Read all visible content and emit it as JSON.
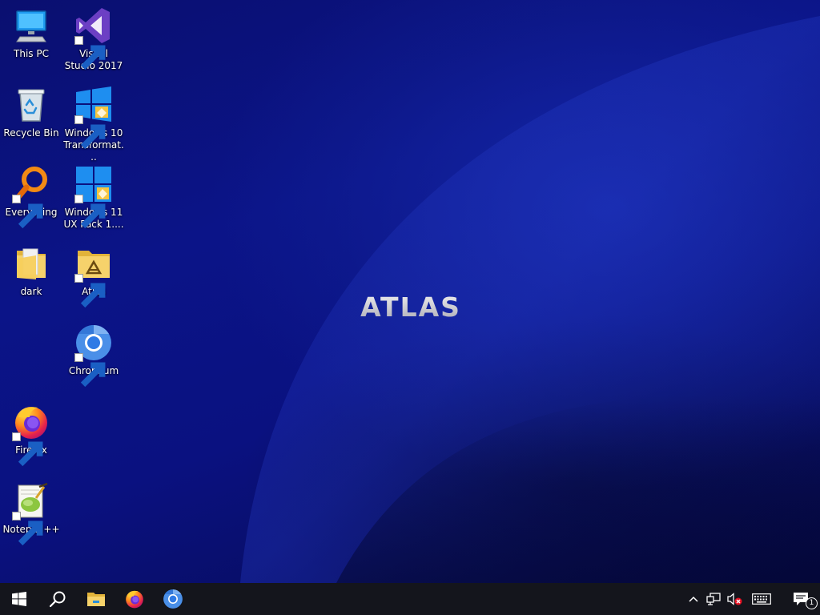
{
  "desktop": {
    "wallpaper_logo_text": "ATLAS",
    "icons": [
      {
        "label": "This PC",
        "icon": "this-pc-icon",
        "shortcut": false
      },
      {
        "label": "Visual Studio 2017",
        "icon": "visual-studio-icon",
        "shortcut": true
      },
      {
        "label": "Recycle Bin",
        "icon": "recycle-bin-icon",
        "shortcut": false
      },
      {
        "label": "Windows 10 Transformat...",
        "icon": "windows-10-transformation-icon",
        "shortcut": true
      },
      {
        "label": "Everything",
        "icon": "everything-search-icon",
        "shortcut": true
      },
      {
        "label": "Windows 11 UX Pack 1....",
        "icon": "windows-11-ux-pack-icon",
        "shortcut": true
      },
      {
        "label": "dark",
        "icon": "folder-icon",
        "shortcut": false
      },
      {
        "label": "Atlas",
        "icon": "atlas-folder-icon",
        "shortcut": true
      },
      {
        "label": "Chromium",
        "icon": "chromium-icon",
        "shortcut": true
      },
      {
        "label": "Firefox",
        "icon": "firefox-icon",
        "shortcut": true
      },
      {
        "label": "Notepad++",
        "icon": "notepad-plus-plus-icon",
        "shortcut": true
      }
    ]
  },
  "taskbar": {
    "buttons": [
      "start-icon",
      "search-icon",
      "file-explorer-icon",
      "firefox-icon",
      "chromium-icon"
    ],
    "tray": [
      "show-hidden-icons-chevron-icon",
      "network-icon",
      "volume-muted-icon",
      "touch-keyboard-icon",
      "action-center-icon"
    ],
    "notification_count": "1"
  },
  "colors": {
    "wallpaper": "#0a1180",
    "taskbar": "#14151c",
    "accent_blue": "#2f7ae5",
    "folder_yellow": "#f4c542"
  }
}
